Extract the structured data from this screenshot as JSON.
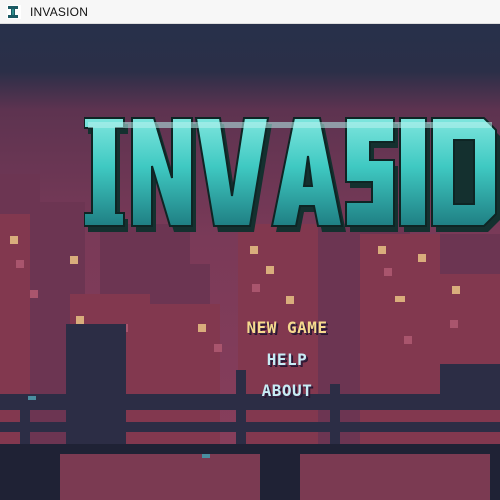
{
  "window": {
    "title": "INVASION",
    "icon": "app-icon"
  },
  "game": {
    "logo_text": "INVASION",
    "menu": [
      {
        "label": "NEW GAME",
        "selected": true
      },
      {
        "label": "HELP",
        "selected": false
      },
      {
        "label": "ABOUT",
        "selected": false
      }
    ],
    "colors": {
      "sky_top": "#27304a",
      "sky_mid": "#6a3552",
      "logo_teal": "#3fc9c2",
      "logo_dark": "#14302f",
      "menu_selected": "#f6d98e",
      "menu_normal": "#c8ecf4",
      "window_lit": "#d9ad7c"
    }
  }
}
